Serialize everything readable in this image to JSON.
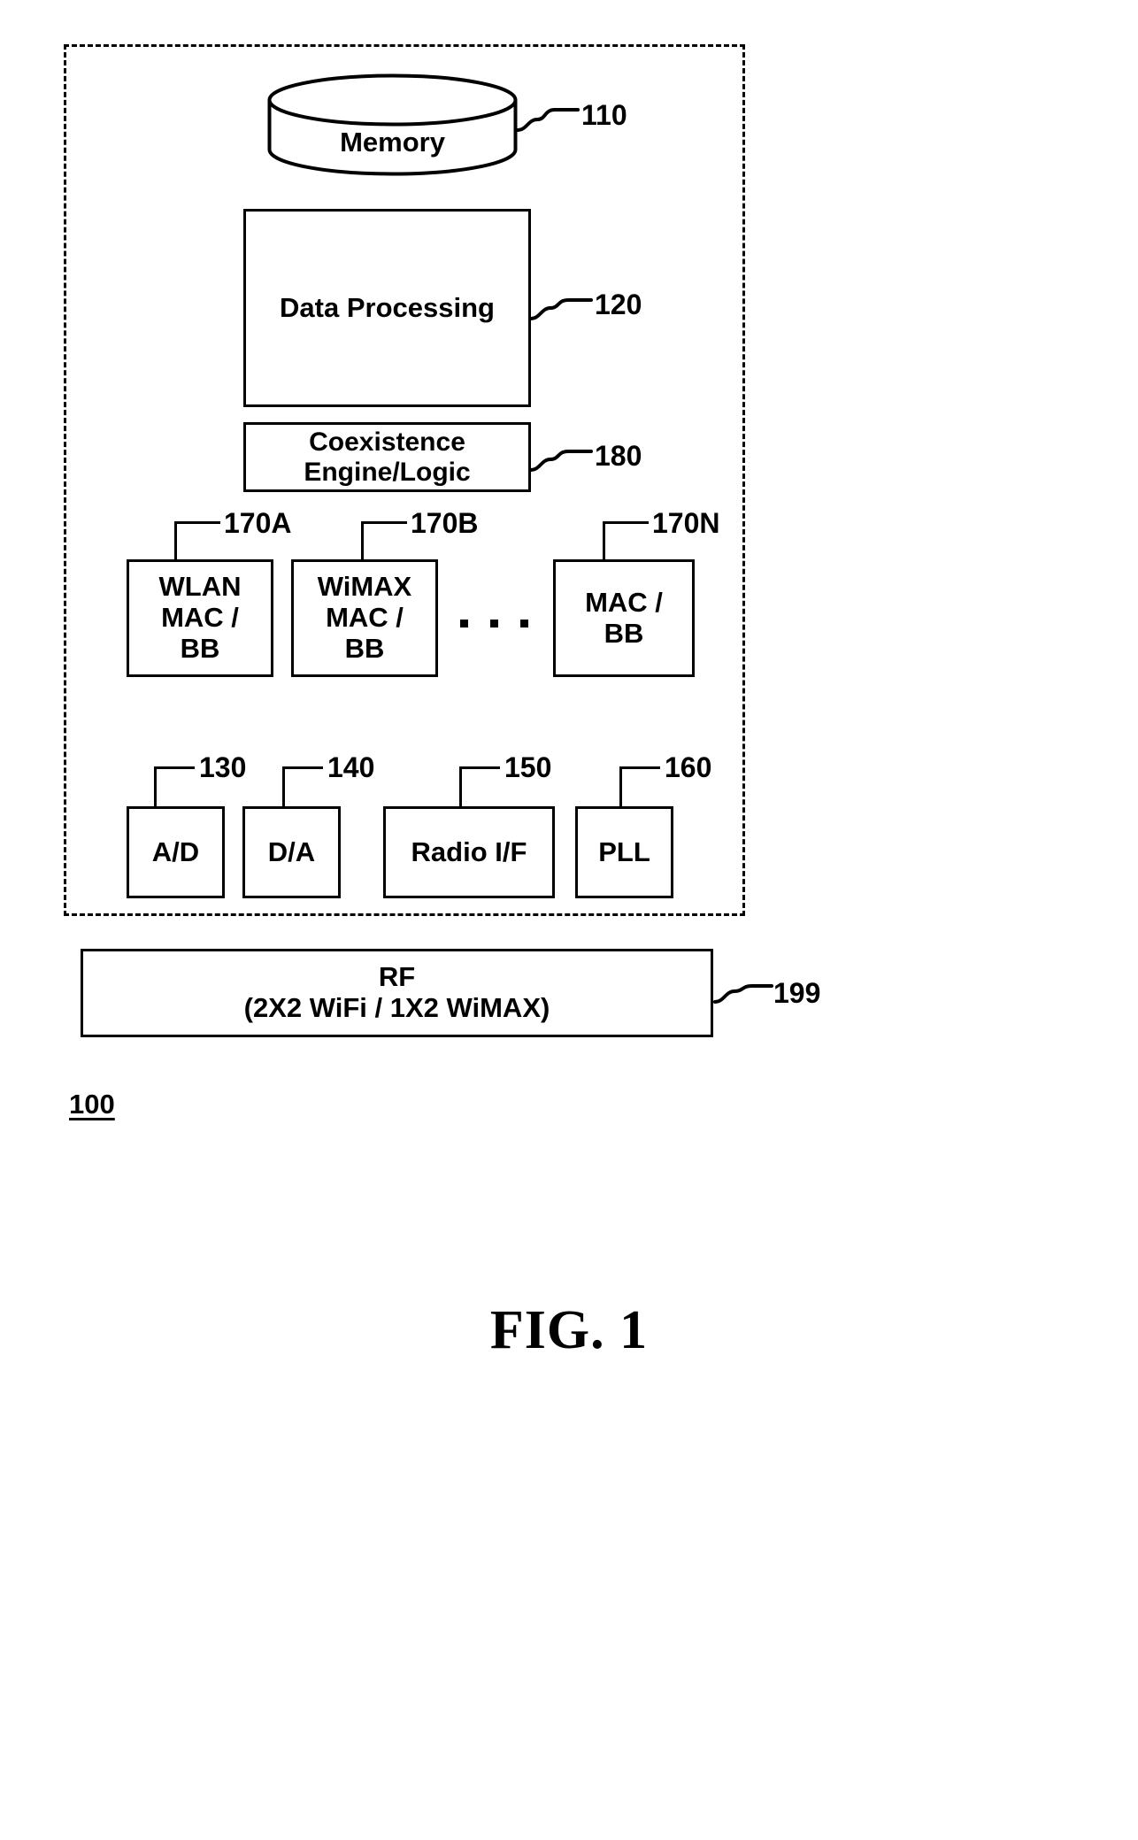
{
  "figure": {
    "caption": "FIG. 1",
    "system_id": "100"
  },
  "boundary": {
    "style": "dashed",
    "name": "system-boundary"
  },
  "components": {
    "memory": {
      "label": "Memory",
      "ref": "110",
      "shape": "cylinder"
    },
    "data_processing": {
      "label": "Data Processing",
      "ref": "120"
    },
    "coexistence": {
      "line1": "Coexistence",
      "line2": "Engine/Logic",
      "ref": "180"
    },
    "mac_blocks": [
      {
        "line1": "WLAN",
        "line2": "MAC /",
        "line3": "BB",
        "ref": "170A"
      },
      {
        "line1": "WiMAX",
        "line2": "MAC /",
        "line3": "BB",
        "ref": "170B"
      },
      {
        "line1": "",
        "line2": "MAC /",
        "line3": "BB",
        "ref": "170N"
      }
    ],
    "ellipsis": "· · ·",
    "io_blocks": [
      {
        "label": "A/D",
        "ref": "130"
      },
      {
        "label": "D/A",
        "ref": "140"
      },
      {
        "label": "Radio I/F",
        "ref": "150"
      },
      {
        "label": "PLL",
        "ref": "160"
      }
    ],
    "rf": {
      "line1": "RF",
      "line2": "(2X2 WiFi / 1X2 WiMAX)",
      "ref": "199"
    }
  },
  "colors": {
    "ink": "#000000",
    "paper": "#ffffff"
  }
}
